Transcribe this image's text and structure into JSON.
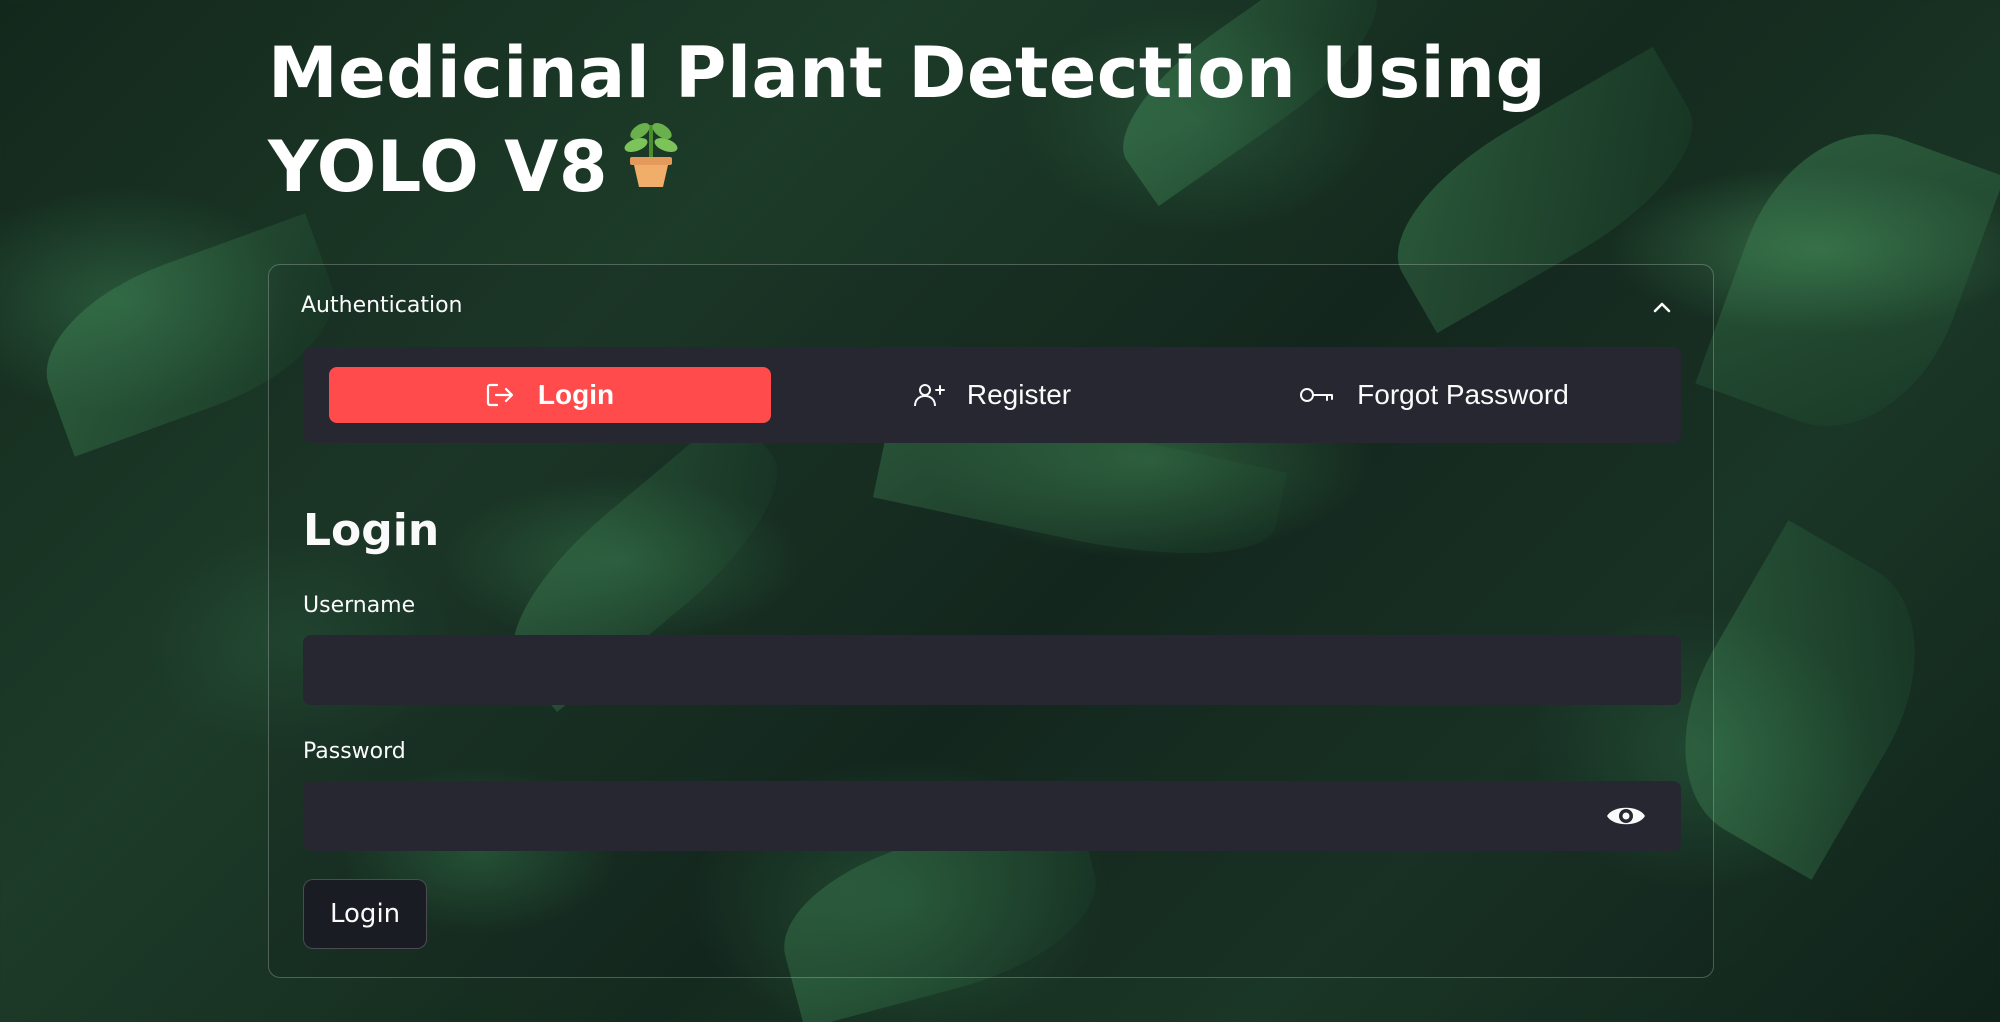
{
  "app": {
    "title": "Medicinal Plant Detection Using YOLO V8",
    "title_icon": "potted-plant-icon"
  },
  "auth_panel": {
    "header_label": "Authentication",
    "expanded": true,
    "collapse_icon": "chevron-up-icon"
  },
  "tabs": [
    {
      "label": "Login",
      "icon": "login-arrow-icon",
      "active": true
    },
    {
      "label": "Register",
      "icon": "user-plus-icon",
      "active": false
    },
    {
      "label": "Forgot Password",
      "icon": "key-icon",
      "active": false
    }
  ],
  "login_form": {
    "title": "Login",
    "username_label": "Username",
    "username_value": "",
    "password_label": "Password",
    "password_value": "",
    "password_toggle_icon": "eye-icon",
    "submit_label": "Login"
  },
  "colors": {
    "accent": "#ff4b4b",
    "input_bg": "#262730",
    "text": "#fafafa"
  }
}
